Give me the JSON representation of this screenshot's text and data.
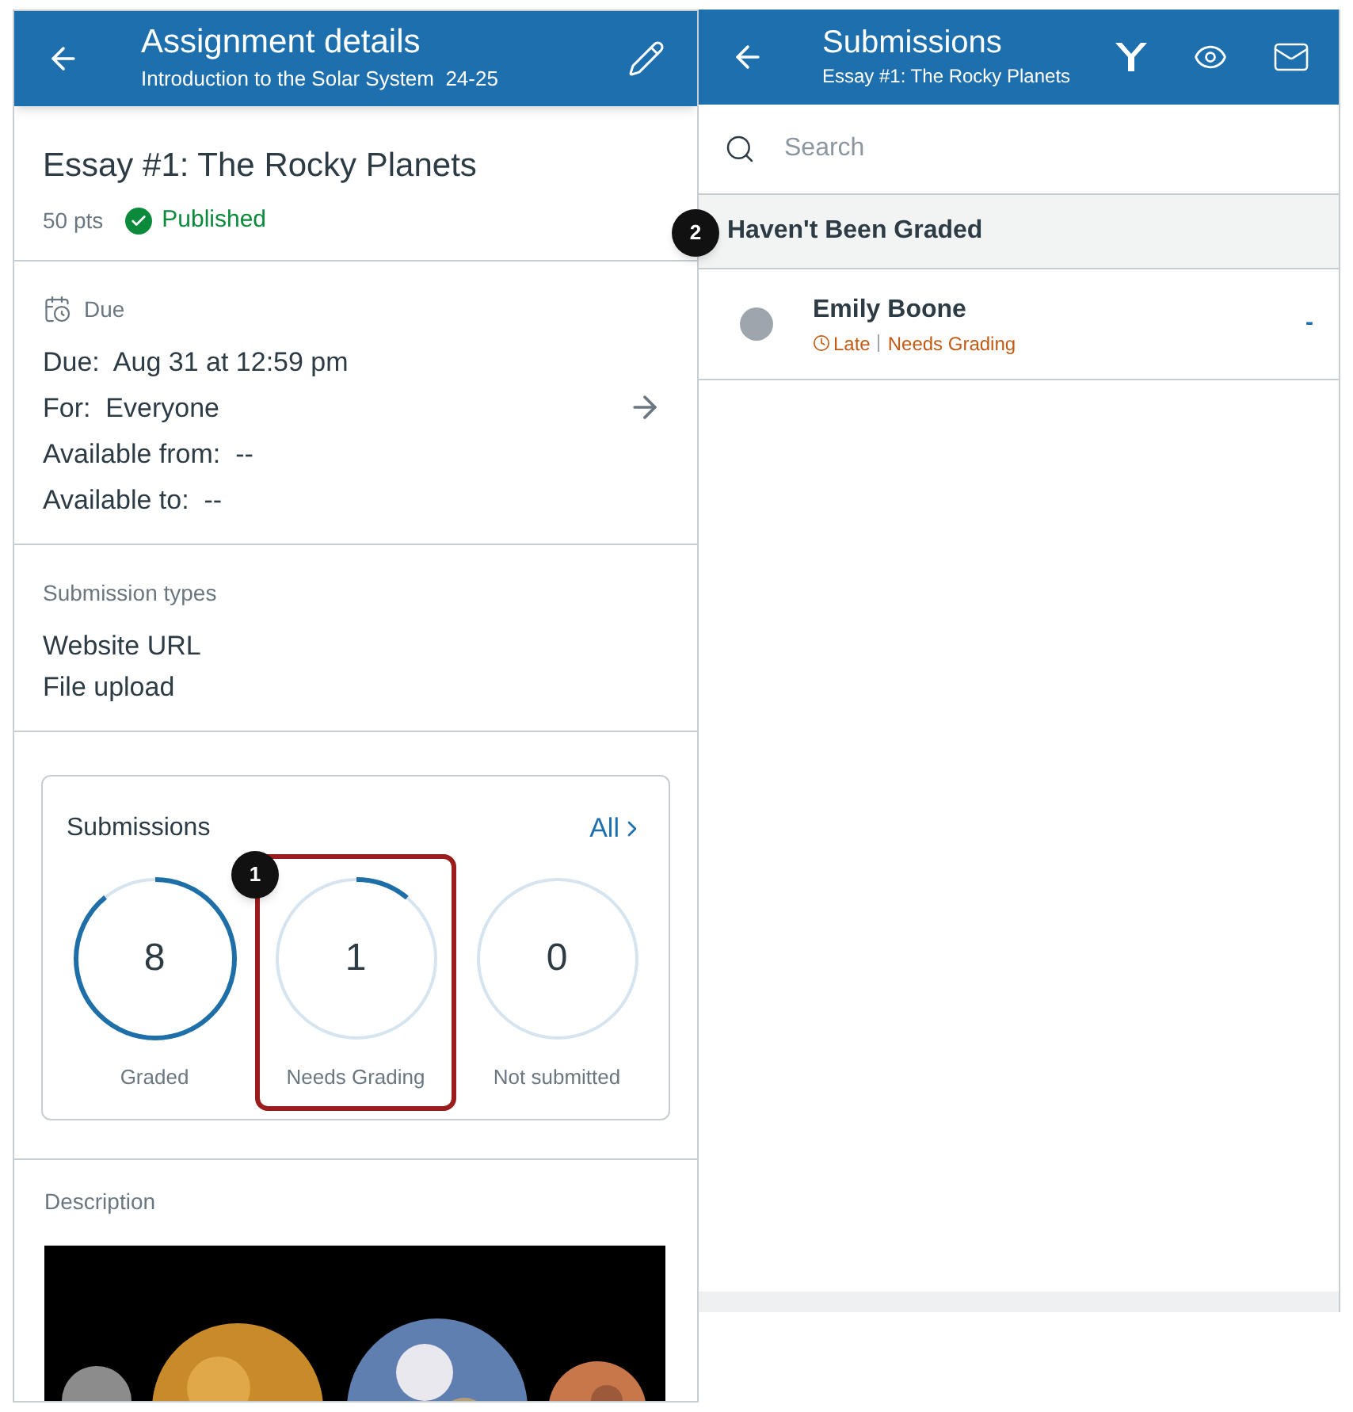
{
  "left": {
    "header": {
      "title": "Assignment details",
      "subtitle": "Introduction to the Solar System  24-25"
    },
    "assignment": {
      "title": "Essay #1: The Rocky Planets",
      "points": "50 pts",
      "status": "Published",
      "published": true
    },
    "due": {
      "heading": "Due",
      "lines": [
        "Due:  Aug 31 at 12:59 pm",
        "For:  Everyone",
        "Available from:  --",
        "Available to:  --"
      ]
    },
    "submission_types": {
      "heading": "Submission types",
      "items": [
        "Website URL",
        "File upload"
      ]
    },
    "submissions": {
      "title": "Submissions",
      "link": "All",
      "stats": [
        {
          "count": "8",
          "label": "Graded",
          "level": 0.89,
          "highlighted": false
        },
        {
          "count": "1",
          "label": "Needs Grading",
          "level": 0.11,
          "highlighted": true
        },
        {
          "count": "0",
          "label": "Not submitted",
          "level": 0,
          "highlighted": false
        }
      ]
    },
    "description": {
      "heading": "Description"
    }
  },
  "right": {
    "header": {
      "title": "Submissions",
      "subtitle": "Essay #1: The Rocky Planets"
    },
    "search": {
      "placeholder": "Search"
    },
    "group": {
      "title": "Haven't Been Graded"
    },
    "rows": [
      {
        "name": "Emily Boone",
        "late": "Late",
        "status": "Needs Grading",
        "grade": "-"
      }
    ]
  },
  "callouts": [
    "1",
    "2"
  ]
}
